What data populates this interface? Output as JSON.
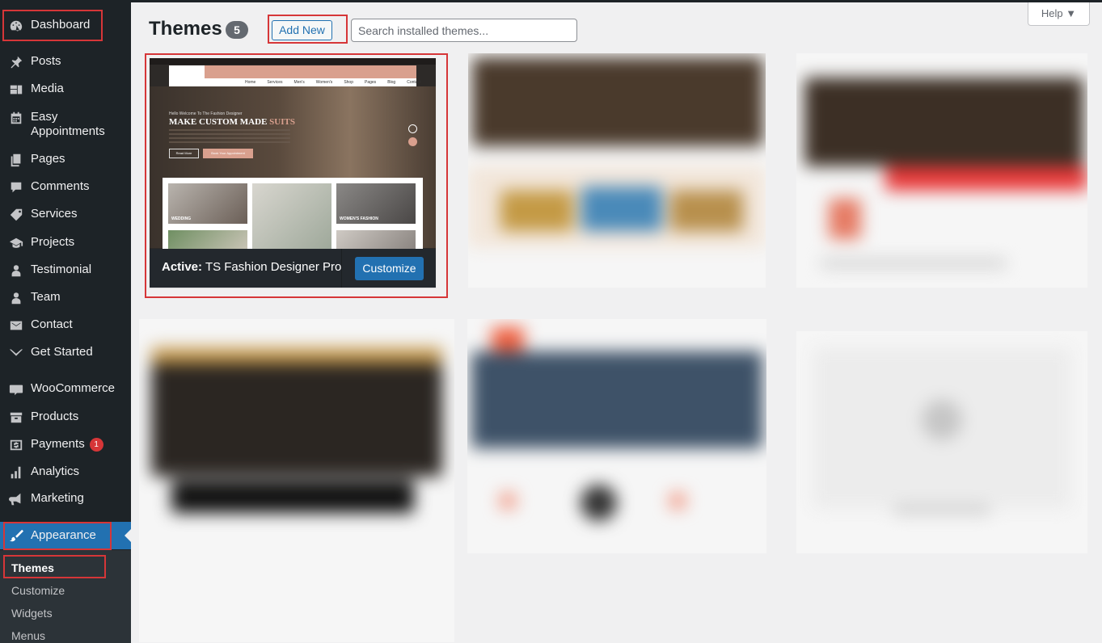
{
  "sidebar": {
    "items": [
      {
        "label": "Dashboard",
        "icon": "dashboard-icon"
      },
      {
        "label": "Posts",
        "icon": "pin-icon"
      },
      {
        "label": "Media",
        "icon": "media-icon"
      },
      {
        "label": "Easy Appointments",
        "icon": "calendar-icon"
      },
      {
        "label": "Pages",
        "icon": "pages-icon"
      },
      {
        "label": "Comments",
        "icon": "comment-icon"
      },
      {
        "label": "Services",
        "icon": "tag-icon"
      },
      {
        "label": "Projects",
        "icon": "graduation-cap-icon"
      },
      {
        "label": "Testimonial",
        "icon": "user-icon"
      },
      {
        "label": "Team",
        "icon": "user-icon"
      },
      {
        "label": "Contact",
        "icon": "envelope-icon"
      },
      {
        "label": "Get Started",
        "icon": "chevron-down-icon"
      },
      {
        "label": "WooCommerce",
        "icon": "woo-icon"
      },
      {
        "label": "Products",
        "icon": "archive-icon"
      },
      {
        "label": "Payments",
        "icon": "money-icon",
        "badge": "1"
      },
      {
        "label": "Analytics",
        "icon": "bar-chart-icon"
      },
      {
        "label": "Marketing",
        "icon": "megaphone-icon"
      },
      {
        "label": "Appearance",
        "icon": "paintbrush-icon"
      }
    ],
    "submenu": [
      "Themes",
      "Customize",
      "Widgets",
      "Menus"
    ]
  },
  "header": {
    "title": "Themes",
    "count": "5",
    "add_new": "Add New",
    "search_placeholder": "Search installed themes...",
    "help": "Help ▼"
  },
  "active_theme": {
    "active_prefix": "Active:",
    "name": "TS Fashion Designer Pro",
    "customize": "Customize",
    "preview": {
      "hero_small": "Hello Welcome To The Fashion Designer",
      "hero_title_a": "MAKE CUSTOM MADE ",
      "hero_title_b": "SUITS",
      "read_more": "Read More",
      "book": "Book Your Appointment",
      "menu": [
        "Home",
        "Services",
        "Men's",
        "Women's",
        "Shop",
        "Pages",
        "Blog",
        "Contact Us"
      ],
      "tiles": [
        "WEDDING",
        "",
        "WOMEN'S FASHION"
      ]
    }
  },
  "colors": {
    "sidebar": "#1d2327",
    "accent": "#2271b1",
    "highlight": "#d63638"
  }
}
